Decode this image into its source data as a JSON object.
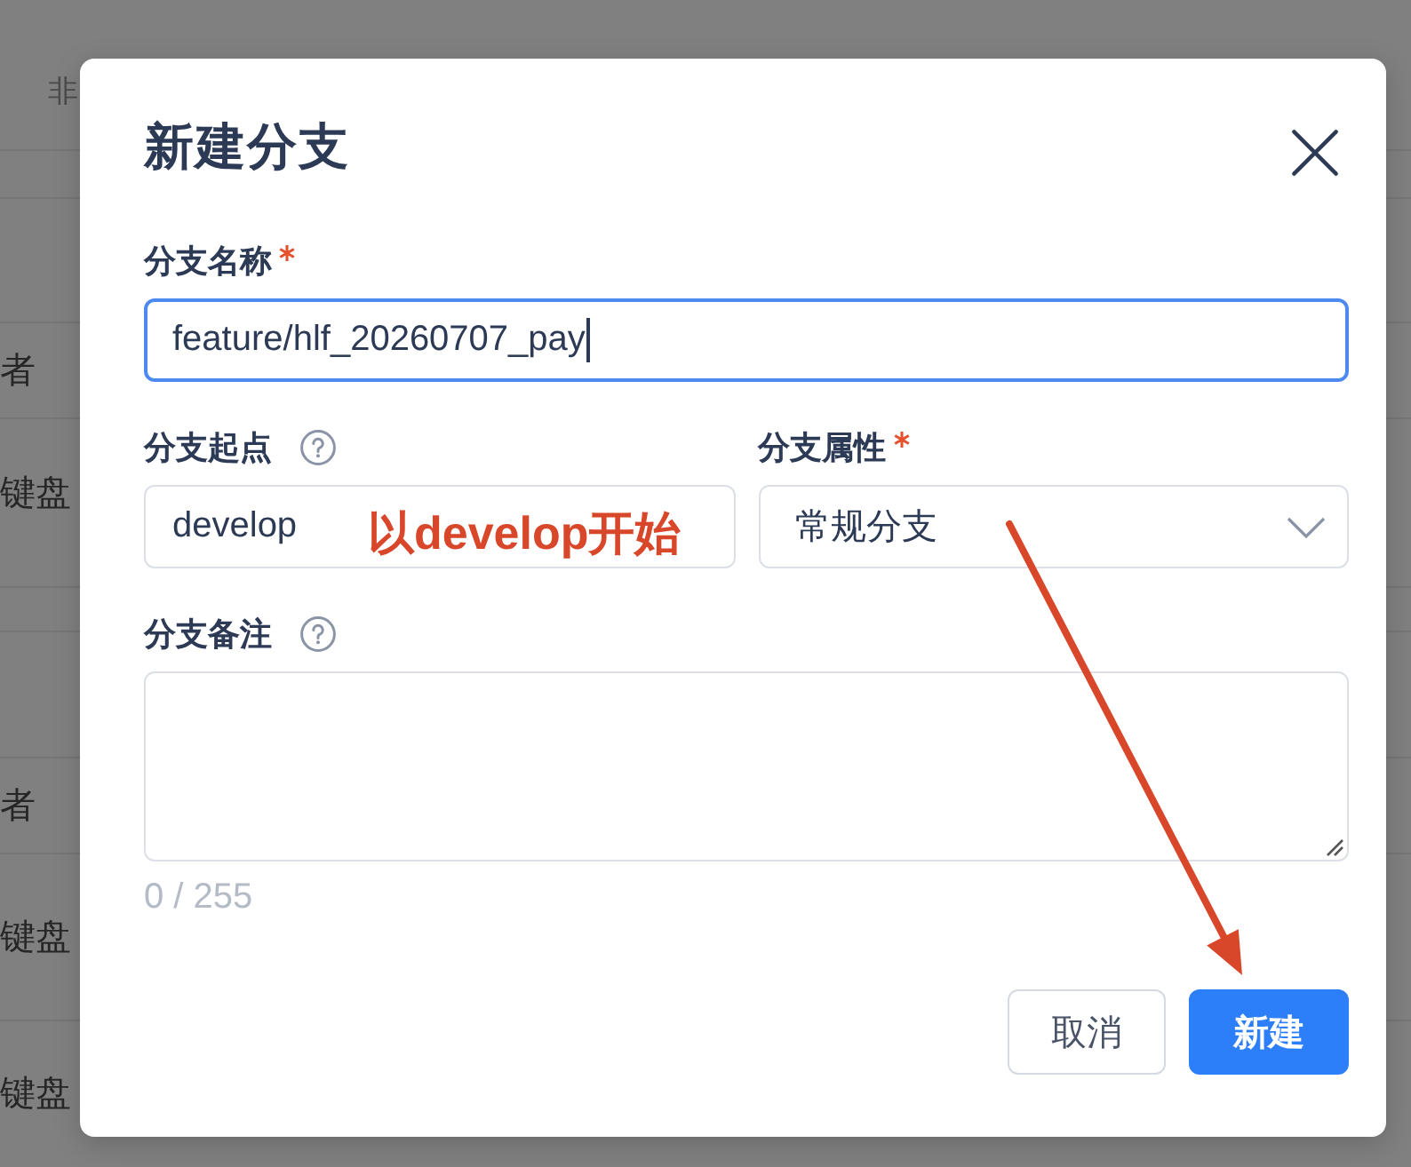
{
  "background_table": {
    "header": "非",
    "rows": [
      {
        "cell": "者"
      },
      {
        "cell": "键盘"
      },
      {
        "cell": "者"
      },
      {
        "cell": "键盘"
      },
      {
        "cell": "键盘"
      }
    ]
  },
  "dialog": {
    "title": "新建分支",
    "rows": [
      [
        {
          "kind": "text",
          "label": "分支名称",
          "required": true,
          "help": false,
          "value": "feature/hlf_20260707_pay",
          "focused": true
        }
      ],
      [
        {
          "kind": "text",
          "label": "分支起点",
          "required": false,
          "help": true,
          "value": "develop",
          "focused": false
        },
        {
          "kind": "select",
          "label": "分支属性",
          "required": true,
          "help": false,
          "value": "常规分支",
          "focused": false
        }
      ],
      [
        {
          "kind": "textarea",
          "label": "分支备注",
          "required": false,
          "help": true,
          "counter": "0 / 255",
          "focused": false
        }
      ]
    ],
    "buttons": [
      {
        "kind": "secondary",
        "label": "取消"
      },
      {
        "kind": "primary",
        "label": "新建"
      }
    ]
  },
  "annotations": [
    {
      "kind": "text",
      "text": "以develop开始"
    },
    {
      "kind": "arrow"
    }
  ]
}
